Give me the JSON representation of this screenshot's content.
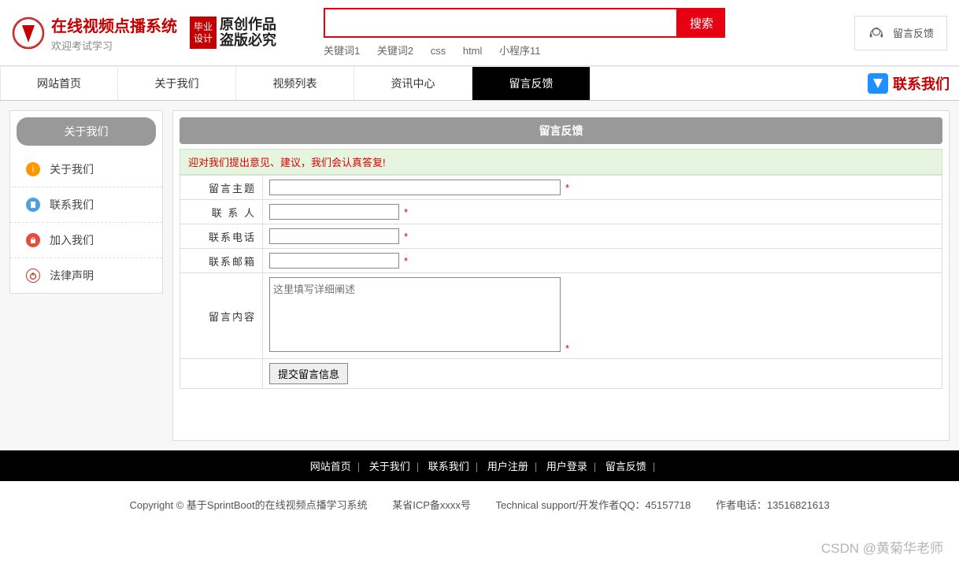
{
  "header": {
    "title": "在线视频点播系统",
    "subtitle": "欢迎考试学习",
    "badge_line1": "毕业",
    "badge_line2": "设计",
    "script_line1": "原创作品",
    "script_line2": "盗版必究",
    "search_placeholder": "",
    "search_btn": "搜索",
    "keywords": [
      "关键词1",
      "关键词2",
      "css",
      "html",
      "小程序11"
    ],
    "top_link": "留言反馈"
  },
  "nav": {
    "items": [
      "网站首页",
      "关于我们",
      "视频列表",
      "资讯中心",
      "留言反馈"
    ],
    "active_index": 4,
    "right_label": "联系我们"
  },
  "sidebar": {
    "title": "关于我们",
    "items": [
      {
        "label": "关于我们",
        "icon": "info",
        "color": "orange"
      },
      {
        "label": "联系我们",
        "icon": "clipboard",
        "color": "blue"
      },
      {
        "label": "加入我们",
        "icon": "lock",
        "color": "red"
      },
      {
        "label": "法律声明",
        "icon": "power",
        "color": "gray"
      }
    ]
  },
  "content": {
    "title": "留言反馈",
    "notice": "迎对我们提出意见、建议，我们会认真答复!",
    "fields": {
      "subject_label": "留言主题",
      "contact_label": "联 系 人",
      "phone_label": "联系电话",
      "email_label": "联系邮箱",
      "body_label": "留言内容",
      "body_placeholder": "这里填写详细阐述"
    },
    "submit_label": "提交留言信息"
  },
  "footer": {
    "links": [
      "网站首页",
      "关于我们",
      "联系我们",
      "用户注册",
      "用户登录",
      "留言反馈"
    ],
    "copyright_prefix": "Copyright © 基于SprintBoot的在线视频点播学习系统",
    "icp": "某省ICP备xxxx号",
    "support": "Technical support/开发作者QQ：45157718",
    "author_phone": "作者电话：13516821613"
  },
  "watermark": "CSDN @黄菊华老师"
}
